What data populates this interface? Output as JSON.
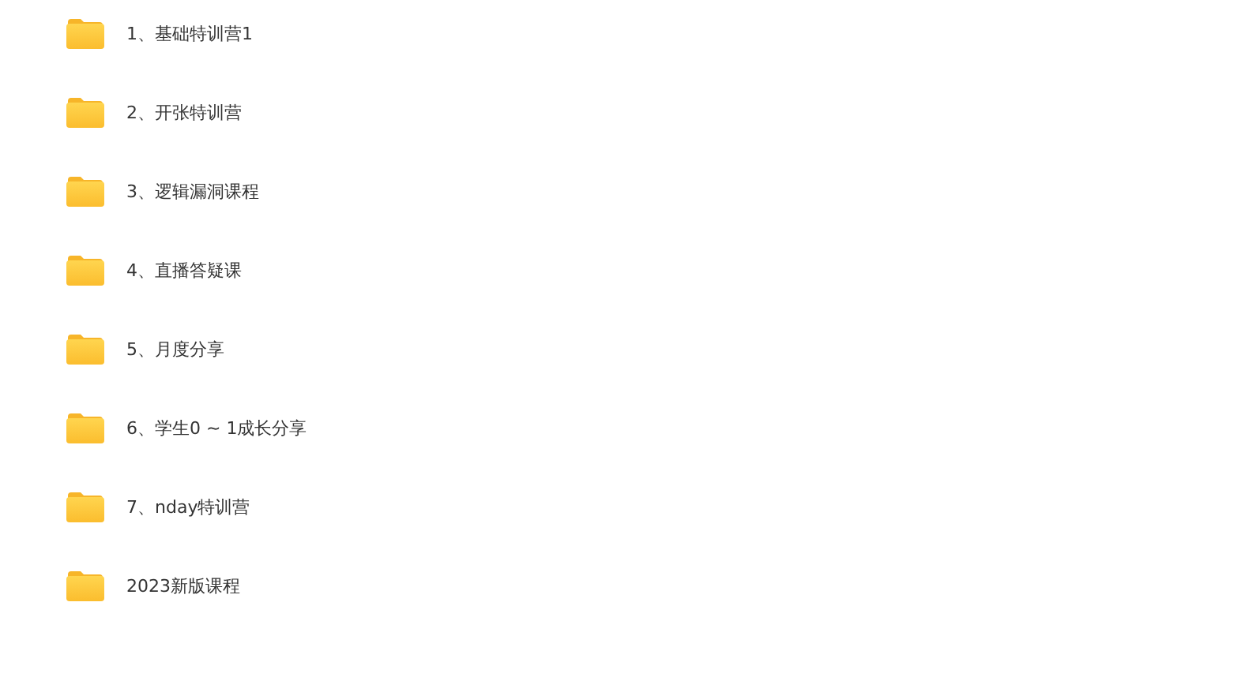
{
  "folders": [
    {
      "name": "1、基础特训营1"
    },
    {
      "name": "2、开张特训营"
    },
    {
      "name": "3、逻辑漏洞课程"
    },
    {
      "name": "4、直播答疑课"
    },
    {
      "name": "5、月度分享"
    },
    {
      "name": "6、学生0 ~ 1成长分享"
    },
    {
      "name": "7、nday特训营"
    },
    {
      "name": "2023新版课程"
    }
  ]
}
